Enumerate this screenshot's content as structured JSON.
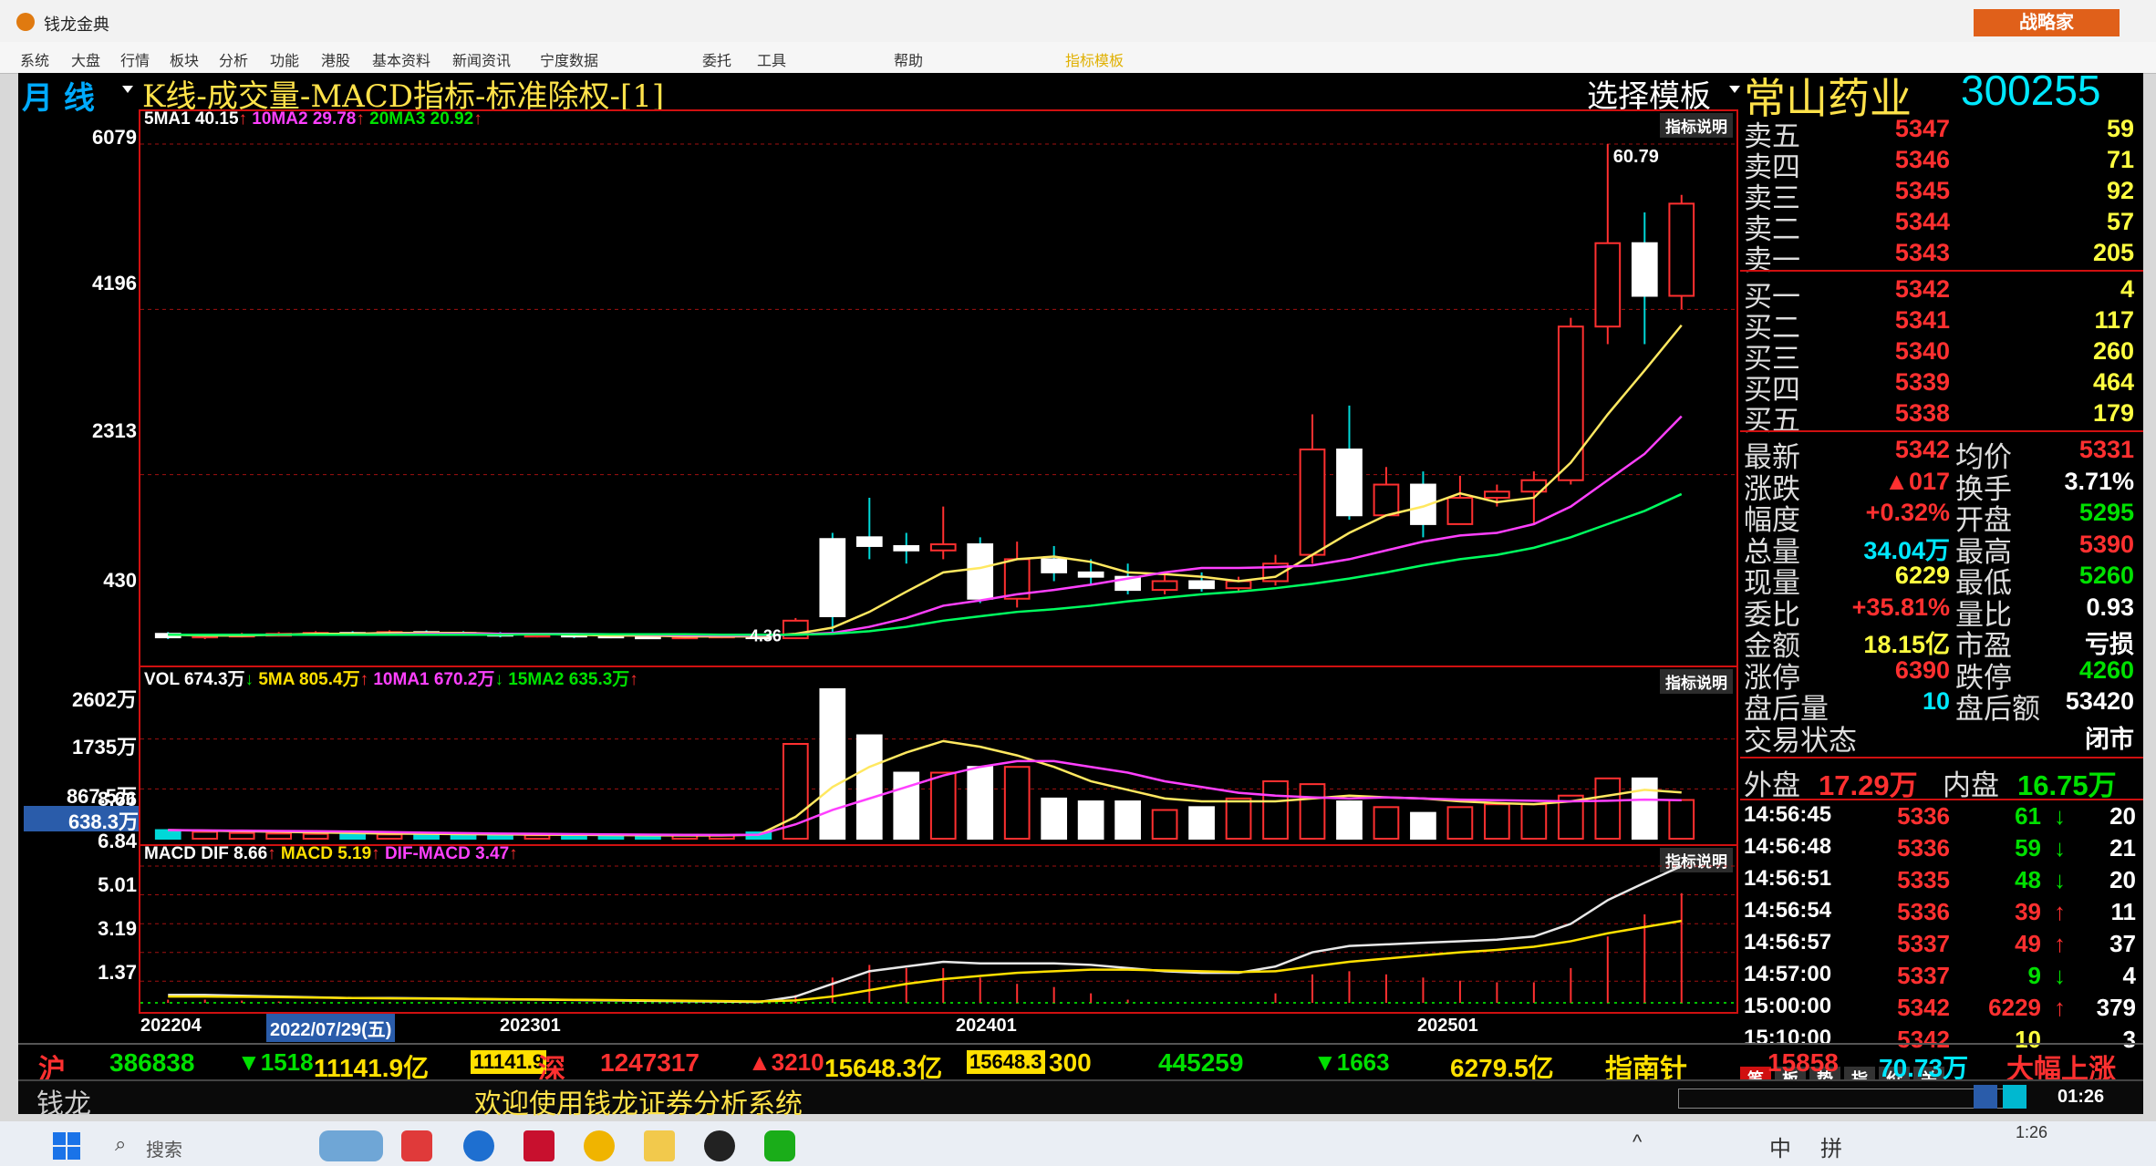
{
  "window": {
    "title": "钱龙金典",
    "badge": "战略家"
  },
  "menu": [
    "系统",
    "大盘",
    "行情",
    "板块",
    "分析",
    "功能",
    "港股",
    "基本资料",
    "新闻资讯",
    "宁度数据",
    "委托",
    "工具",
    "帮助",
    "指标模板"
  ],
  "header": {
    "period": "月 线",
    "chart_title": "K线-成交量-MACD指标-标准除权-[1]",
    "template_selector": "选择模板",
    "stock_name": "常山药业",
    "stock_code": "300255"
  },
  "price_panel": {
    "ma_labels": [
      "5MA1 40.15",
      "10MA2 29.78",
      "20MA3 20.92"
    ],
    "ma_colors": [
      "#ffffff",
      "#ff40ff",
      "#00ff60"
    ],
    "explain": "指标说明",
    "y_ticks": [
      "6079",
      "4196",
      "2313",
      "430"
    ],
    "high_label": "60.79",
    "low_label": "4.36"
  },
  "volume_panel": {
    "labels": [
      "VOL 674.3万",
      "5MA 805.4万",
      "10MA1 670.2万",
      "15MA2 635.3万"
    ],
    "explain": "指标说明",
    "y_ticks": [
      "2602万",
      "1735万",
      "867.5万"
    ],
    "cursor_value": "638.3万"
  },
  "macd_panel": {
    "labels": [
      "MACD DIF 8.66",
      "MACD 5.19",
      "DIF-MACD 3.47"
    ],
    "explain": "指标说明",
    "y_ticks": [
      "8.66",
      "6.84",
      "5.01",
      "3.19",
      "1.37"
    ]
  },
  "x_axis": {
    "labels": [
      "202204",
      "2022/07/29(五)",
      "202301",
      "202401",
      "202501"
    ]
  },
  "chart_data": {
    "type": "candlestick",
    "title": "K线-成交量-MACD指标-标准除权-[1]",
    "period": "月线",
    "candles": [
      {
        "o": 5.0,
        "c": 4.6,
        "h": 5.2,
        "l": 4.4
      },
      {
        "o": 4.6,
        "c": 4.8,
        "h": 5.0,
        "l": 4.4
      },
      {
        "o": 4.8,
        "c": 4.9,
        "h": 5.1,
        "l": 4.6
      },
      {
        "o": 4.9,
        "c": 5.0,
        "h": 5.2,
        "l": 4.7
      },
      {
        "o": 5.0,
        "c": 5.1,
        "h": 5.3,
        "l": 4.8
      },
      {
        "o": 5.1,
        "c": 5.0,
        "h": 5.3,
        "l": 4.9
      },
      {
        "o": 5.0,
        "c": 5.2,
        "h": 5.4,
        "l": 4.9
      },
      {
        "o": 5.2,
        "c": 5.1,
        "h": 5.4,
        "l": 4.9
      },
      {
        "o": 5.1,
        "c": 5.0,
        "h": 5.3,
        "l": 4.8
      },
      {
        "o": 5.0,
        "c": 4.8,
        "h": 5.2,
        "l": 4.6
      },
      {
        "o": 4.8,
        "c": 4.9,
        "h": 5.1,
        "l": 4.6
      },
      {
        "o": 4.9,
        "c": 4.8,
        "h": 5.0,
        "l": 4.5
      },
      {
        "o": 4.8,
        "c": 4.7,
        "h": 5.0,
        "l": 4.5
      },
      {
        "o": 4.7,
        "c": 4.6,
        "h": 4.9,
        "l": 4.4
      },
      {
        "o": 4.6,
        "c": 4.7,
        "h": 4.9,
        "l": 4.4
      },
      {
        "o": 4.7,
        "c": 4.8,
        "h": 5.0,
        "l": 4.5
      },
      {
        "o": 4.8,
        "c": 4.5,
        "h": 4.9,
        "l": 4.36
      },
      {
        "o": 4.5,
        "c": 6.5,
        "h": 6.8,
        "l": 4.4
      },
      {
        "o": 15.8,
        "c": 7.0,
        "h": 16.5,
        "l": 5.2
      },
      {
        "o": 16.0,
        "c": 15.0,
        "h": 20.5,
        "l": 13.5
      },
      {
        "o": 15.0,
        "c": 14.5,
        "h": 16.5,
        "l": 13.0
      },
      {
        "o": 14.5,
        "c": 15.2,
        "h": 19.5,
        "l": 13.5
      },
      {
        "o": 15.2,
        "c": 9.0,
        "h": 16.0,
        "l": 8.5
      },
      {
        "o": 9.0,
        "c": 13.5,
        "h": 15.5,
        "l": 8.0
      },
      {
        "o": 13.5,
        "c": 12.0,
        "h": 15.0,
        "l": 11.0
      },
      {
        "o": 12.0,
        "c": 11.5,
        "h": 13.5,
        "l": 10.5
      },
      {
        "o": 11.5,
        "c": 10.0,
        "h": 13.0,
        "l": 9.5
      },
      {
        "o": 10.0,
        "c": 11.0,
        "h": 12.0,
        "l": 9.5
      },
      {
        "o": 11.0,
        "c": 10.2,
        "h": 12.0,
        "l": 9.8
      },
      {
        "o": 10.2,
        "c": 11.0,
        "h": 11.5,
        "l": 9.8
      },
      {
        "o": 11.0,
        "c": 13.0,
        "h": 14.0,
        "l": 10.5
      },
      {
        "o": 14.0,
        "c": 26.0,
        "h": 30.0,
        "l": 13.0
      },
      {
        "o": 26.0,
        "c": 18.5,
        "h": 31.0,
        "l": 18.0
      },
      {
        "o": 18.5,
        "c": 22.0,
        "h": 24.0,
        "l": 19.5
      },
      {
        "o": 22.0,
        "c": 17.5,
        "h": 23.5,
        "l": 16.0
      },
      {
        "o": 17.5,
        "c": 20.5,
        "h": 23.0,
        "l": 18.0
      },
      {
        "o": 20.5,
        "c": 21.2,
        "h": 22.0,
        "l": 19.5
      },
      {
        "o": 21.2,
        "c": 22.5,
        "h": 23.5,
        "l": 17.5
      },
      {
        "o": 22.5,
        "c": 40.0,
        "h": 41.0,
        "l": 22.0
      },
      {
        "o": 40.0,
        "c": 49.5,
        "h": 60.79,
        "l": 38.0
      },
      {
        "o": 49.5,
        "c": 43.5,
        "h": 53.0,
        "l": 38.0
      },
      {
        "o": 43.5,
        "c": 54.0,
        "h": 55.0,
        "l": 42.0
      }
    ],
    "ma5": [
      4.9,
      4.8,
      4.8,
      4.9,
      5.0,
      5.0,
      5.1,
      5.1,
      5.1,
      5.0,
      5.0,
      4.9,
      4.8,
      4.8,
      4.7,
      4.7,
      4.7,
      5.0,
      5.7,
      7.5,
      9.8,
      12.0,
      12.5,
      13.5,
      13.8,
      13.2,
      12.0,
      11.8,
      11.5,
      11.0,
      11.5,
      14.0,
      16.5,
      18.5,
      19.5,
      21.0,
      20.0,
      20.5,
      24.5,
      30.0,
      35.0,
      40.15
    ],
    "ma10": [
      4.9,
      4.9,
      4.9,
      4.9,
      4.9,
      4.9,
      4.95,
      5.0,
      5.0,
      5.0,
      5.0,
      5.0,
      4.95,
      4.9,
      4.85,
      4.8,
      4.8,
      4.9,
      5.1,
      5.8,
      6.8,
      8.2,
      8.8,
      9.5,
      10.0,
      10.6,
      11.3,
      12.0,
      12.5,
      12.5,
      12.6,
      12.8,
      13.5,
      14.5,
      15.5,
      16.2,
      16.5,
      17.5,
      19.5,
      22.5,
      25.5,
      29.78
    ],
    "ma20": [
      4.9,
      4.9,
      4.9,
      4.9,
      4.9,
      4.9,
      4.9,
      4.9,
      4.9,
      4.9,
      4.95,
      4.95,
      4.95,
      4.95,
      4.95,
      4.9,
      4.9,
      4.9,
      5.0,
      5.3,
      5.8,
      6.5,
      7.0,
      7.5,
      7.8,
      8.2,
      8.7,
      9.1,
      9.5,
      9.8,
      10.2,
      10.7,
      11.3,
      12.0,
      12.8,
      13.5,
      14.0,
      14.8,
      16.0,
      17.5,
      19.0,
      20.92
    ],
    "price_ylim": [
      4.3,
      60.79
    ],
    "volume": [
      150,
      120,
      100,
      90,
      85,
      80,
      75,
      70,
      70,
      65,
      60,
      60,
      55,
      55,
      60,
      60,
      110,
      1650,
      2602,
      1800,
      1150,
      1150,
      1250,
      1250,
      700,
      650,
      650,
      500,
      550,
      700,
      1000,
      950,
      650,
      550,
      450,
      550,
      600,
      600,
      750,
      1050,
      1050,
      674.3
    ],
    "vol_ma5": [
      150,
      140,
      130,
      120,
      110,
      100,
      90,
      85,
      80,
      75,
      72,
      68,
      64,
      60,
      58,
      57,
      70,
      380,
      900,
      1250,
      1500,
      1700,
      1600,
      1450,
      1250,
      1000,
      850,
      700,
      650,
      650,
      650,
      700,
      750,
      720,
      700,
      650,
      620,
      600,
      650,
      750,
      850,
      805.4
    ],
    "vol_ma10": [
      150,
      145,
      140,
      135,
      130,
      125,
      115,
      105,
      98,
      90,
      85,
      80,
      75,
      72,
      68,
      65,
      70,
      250,
      500,
      700,
      900,
      1100,
      1250,
      1350,
      1350,
      1250,
      1150,
      1000,
      900,
      800,
      750,
      720,
      700,
      720,
      700,
      680,
      670,
      660,
      650,
      660,
      680,
      670.2
    ],
    "vol_ylim": [
      0,
      2602
    ],
    "dif": [
      0.5,
      0.5,
      0.45,
      0.4,
      0.35,
      0.3,
      0.3,
      0.28,
      0.25,
      0.22,
      0.2,
      0.18,
      0.15,
      0.12,
      0.1,
      0.08,
      0.05,
      0.4,
      1.2,
      2.0,
      2.3,
      2.6,
      2.5,
      2.5,
      2.5,
      2.4,
      2.2,
      2.0,
      1.9,
      1.9,
      2.3,
      3.2,
      3.6,
      3.7,
      3.8,
      3.9,
      4.0,
      4.2,
      5.0,
      6.5,
      7.6,
      8.66
    ],
    "dea": [
      0.4,
      0.4,
      0.38,
      0.36,
      0.33,
      0.3,
      0.28,
      0.27,
      0.25,
      0.23,
      0.21,
      0.19,
      0.17,
      0.15,
      0.13,
      0.11,
      0.09,
      0.15,
      0.4,
      0.8,
      1.2,
      1.5,
      1.7,
      1.9,
      2.0,
      2.1,
      2.1,
      2.05,
      2.0,
      1.95,
      2.0,
      2.3,
      2.6,
      2.8,
      3.0,
      3.2,
      3.35,
      3.55,
      3.9,
      4.4,
      4.8,
      5.19
    ],
    "macd_ylim": [
      0,
      8.66
    ]
  },
  "quote": {
    "sells": [
      {
        "label": "卖五",
        "price": "5347",
        "vol": "59"
      },
      {
        "label": "卖四",
        "price": "5346",
        "vol": "71"
      },
      {
        "label": "卖三",
        "price": "5345",
        "vol": "92"
      },
      {
        "label": "卖二",
        "price": "5344",
        "vol": "57"
      },
      {
        "label": "卖一",
        "price": "5343",
        "vol": "205"
      }
    ],
    "buys": [
      {
        "label": "买一",
        "price": "5342",
        "vol": "4"
      },
      {
        "label": "买二",
        "price": "5341",
        "vol": "117"
      },
      {
        "label": "买三",
        "price": "5340",
        "vol": "260"
      },
      {
        "label": "买四",
        "price": "5339",
        "vol": "464"
      },
      {
        "label": "买五",
        "price": "5338",
        "vol": "179"
      }
    ],
    "stats": [
      {
        "l1": "最新",
        "v1": "5342",
        "c1": "#ff3030",
        "l2": "均价",
        "v2": "5331",
        "c2": "#ff3030"
      },
      {
        "l1": "涨跌",
        "v1": "▲017",
        "c1": "#ff3030",
        "l2": "换手",
        "v2": "3.71%",
        "c2": "#ffffff"
      },
      {
        "l1": "幅度",
        "v1": "+0.32%",
        "c1": "#ff3030",
        "l2": "开盘",
        "v2": "5295",
        "c2": "#00e000"
      },
      {
        "l1": "总量",
        "v1": "34.04万",
        "c1": "#00e8ff",
        "l2": "最高",
        "v2": "5390",
        "c2": "#ff3030"
      },
      {
        "l1": "现量",
        "v1": "6229",
        "c1": "#ffff40",
        "l2": "最低",
        "v2": "5260",
        "c2": "#00e000"
      },
      {
        "l1": "委比",
        "v1": "+35.81%",
        "c1": "#ff3030",
        "l2": "量比",
        "v2": "0.93",
        "c2": "#ffffff"
      },
      {
        "l1": "金额",
        "v1": "18.15亿",
        "c1": "#ffff40",
        "l2": "市盈",
        "v2": "亏损",
        "c2": "#ffffff"
      },
      {
        "l1": "涨停",
        "v1": "6390",
        "c1": "#ff3030",
        "l2": "跌停",
        "v2": "4260",
        "c2": "#00e000"
      },
      {
        "l1": "盘后量",
        "v1": "10",
        "c1": "#00e8ff",
        "l2": "盘后额",
        "v2": "53420",
        "c2": "#ffffff"
      },
      {
        "l1": "交易状态",
        "v1": "",
        "c1": "#ffffff",
        "l2": "",
        "v2": "闭市",
        "c2": "#ffffff"
      }
    ],
    "outer_label": "外盘",
    "outer": "17.29万",
    "inner_label": "内盘",
    "inner": "16.75万",
    "ticks": [
      {
        "t": "14:56:45",
        "p": "5336",
        "v": "61",
        "d": "↓",
        "n": "20",
        "dc": "#00e000"
      },
      {
        "t": "14:56:48",
        "p": "5336",
        "v": "59",
        "d": "↓",
        "n": "21",
        "dc": "#00e000"
      },
      {
        "t": "14:56:51",
        "p": "5335",
        "v": "48",
        "d": "↓",
        "n": "20",
        "dc": "#00e000"
      },
      {
        "t": "14:56:54",
        "p": "5336",
        "v": "39",
        "d": "↑",
        "n": "11",
        "dc": "#ff3030"
      },
      {
        "t": "14:56:57",
        "p": "5337",
        "v": "49",
        "d": "↑",
        "n": "37",
        "dc": "#ff3030"
      },
      {
        "t": "14:57:00",
        "p": "5337",
        "v": "9",
        "d": "↓",
        "n": "4",
        "dc": "#00e000"
      },
      {
        "t": "15:00:00",
        "p": "5342",
        "v": "6229",
        "d": "↑",
        "n": "379",
        "dc": "#ff3030"
      },
      {
        "t": "15:10:00",
        "p": "5342",
        "v": "10",
        "d": "",
        "n": "3",
        "dc": "#ffffff"
      }
    ],
    "tabs": [
      "笔",
      "板",
      "势",
      "指",
      "价",
      "关"
    ]
  },
  "index_bar": {
    "items": [
      {
        "name": "沪",
        "value": "386838",
        "chg": "▼1518",
        "amt": "11141.9亿",
        "amt2": "11141.9"
      },
      {
        "name": "深",
        "value": "1247317",
        "chg": "▲3210",
        "amt": "15648.3亿",
        "amt2": "15648.3"
      },
      {
        "name": "300",
        "value": "445259",
        "chg": "▼1663",
        "amt": "6279.5亿",
        "amt2": ""
      }
    ],
    "compass_label": "指南针",
    "compass_value": "15858",
    "compass_amt": "70.73万",
    "compass_status": "大幅上涨"
  },
  "status_bar": {
    "brand": "钱龙",
    "message": "欢迎使用钱龙证券分析系统",
    "time": "01:26"
  },
  "taskbar": {
    "search_placeholder": "搜索",
    "ime": "中",
    "ime2": "拼",
    "clock": "1:26"
  }
}
